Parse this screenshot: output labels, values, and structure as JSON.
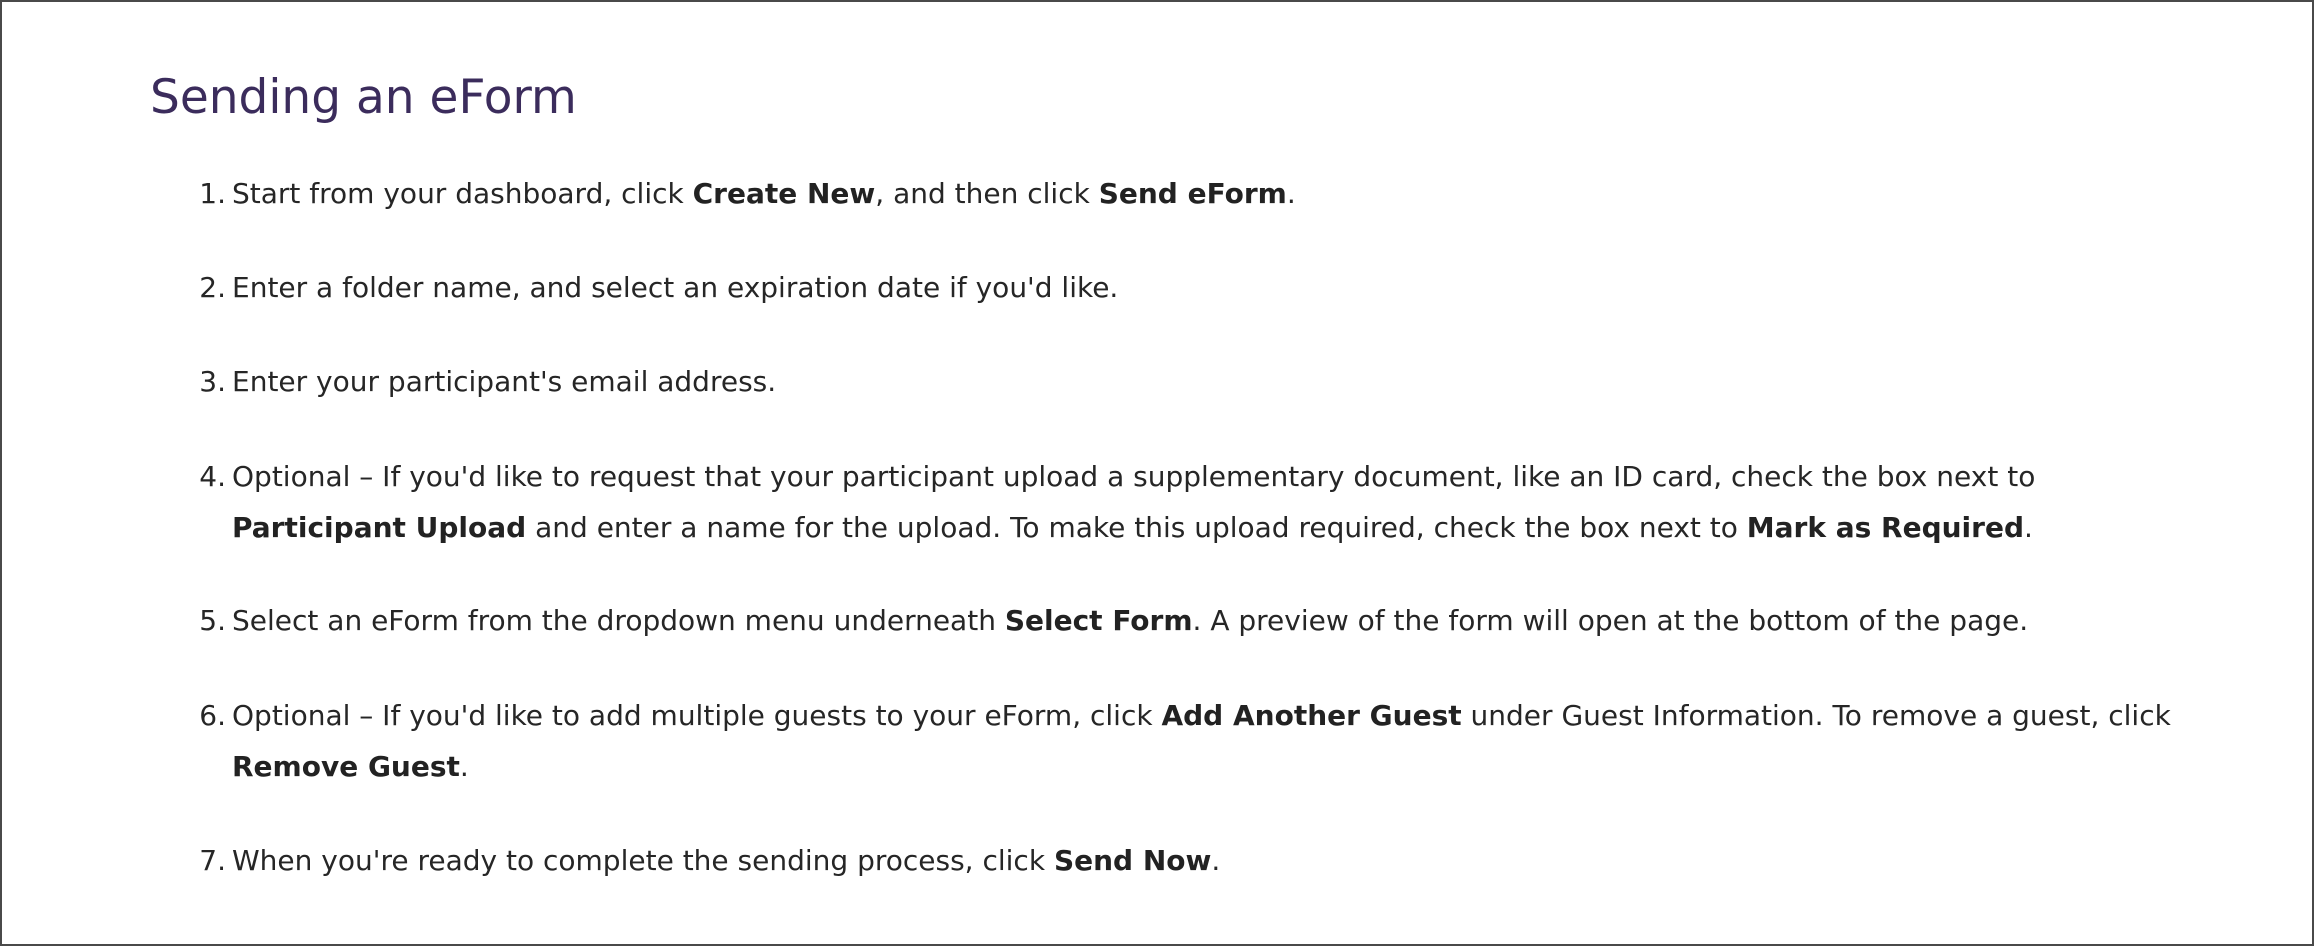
{
  "page": {
    "title": "Sending an eForm"
  },
  "steps": [
    {
      "number": "1.",
      "segments": [
        {
          "text": "Start from your dashboard, click ",
          "bold": false
        },
        {
          "text": "Create New",
          "bold": true
        },
        {
          "text": ", and then click ",
          "bold": false
        },
        {
          "text": "Send eForm",
          "bold": true
        },
        {
          "text": ".",
          "bold": false
        }
      ]
    },
    {
      "number": "2.",
      "segments": [
        {
          "text": "Enter a folder name, and select an expiration date if you'd like.",
          "bold": false
        }
      ]
    },
    {
      "number": "3.",
      "segments": [
        {
          "text": "Enter your participant's email address.",
          "bold": false
        }
      ]
    },
    {
      "number": "4.",
      "segments": [
        {
          "text": "Optional – If you'd like to request that your participant upload a supplementary document, like an ID card, check the box next to ",
          "bold": false
        },
        {
          "text": "Participant Upload",
          "bold": true
        },
        {
          "text": " and enter a name for the upload. To make this upload required, check the box next to ",
          "bold": false
        },
        {
          "text": "Mark as Required",
          "bold": true
        },
        {
          "text": ".",
          "bold": false
        }
      ]
    },
    {
      "number": "5.",
      "segments": [
        {
          "text": "Select an eForm from the dropdown menu underneath ",
          "bold": false
        },
        {
          "text": "Select Form",
          "bold": true
        },
        {
          "text": ". A preview of the form will open at the bottom of the page.",
          "bold": false
        }
      ]
    },
    {
      "number": "6.",
      "segments": [
        {
          "text": "Optional – If you'd like to add multiple guests to your eForm, click ",
          "bold": false
        },
        {
          "text": "Add Another Guest",
          "bold": true
        },
        {
          "text": " under Guest Information.  To remove a guest, click ",
          "bold": false
        },
        {
          "text": "Remove Guest",
          "bold": true
        },
        {
          "text": ".",
          "bold": false
        }
      ]
    },
    {
      "number": "7.",
      "segments": [
        {
          "text": "When you're ready to complete the sending process, click ",
          "bold": false
        },
        {
          "text": "Send Now",
          "bold": true
        },
        {
          "text": ".",
          "bold": false
        }
      ]
    }
  ]
}
